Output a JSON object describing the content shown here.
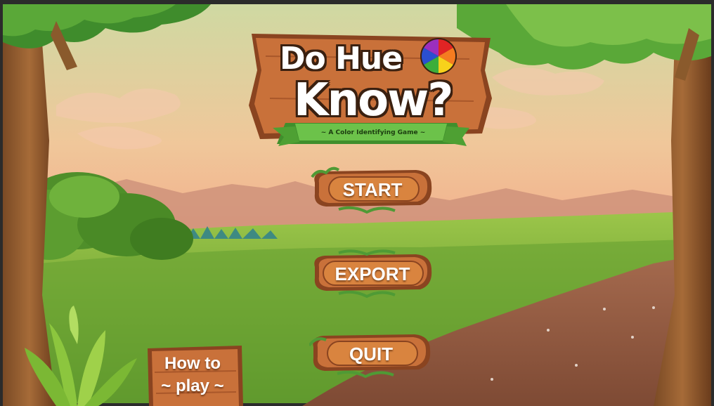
{
  "title": {
    "line1": "Do Hue",
    "line2": "Know?",
    "subtitle": "~ A Color Identifying Game ~"
  },
  "menu": {
    "start_label": "START",
    "export_label": "EXPORT",
    "quit_label": "QUIT"
  },
  "howto": {
    "line1": "How to",
    "line2": "~ play ~"
  },
  "colors": {
    "sky_top": "#c9d8a0",
    "sky_bottom": "#f2a98a",
    "grass": "#7fb33a",
    "wood": "#c9713a",
    "wood_dark": "#8a4420",
    "ribbon": "#6cc24a"
  }
}
